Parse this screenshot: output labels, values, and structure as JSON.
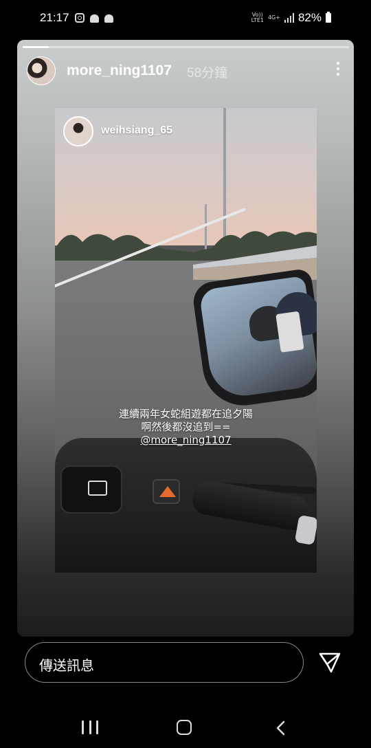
{
  "status_bar": {
    "time": "21:17",
    "network_type_top": "Vo))",
    "network_type_bottom": "LTE1",
    "network_gen": "4G+",
    "battery": "82%",
    "icons": [
      "instagram-icon",
      "android-icon",
      "android-icon",
      "signal-icon",
      "battery-icon"
    ]
  },
  "story": {
    "progress": 0.08,
    "username": "more_ning1107",
    "timestamp": "58分鐘",
    "more_icon": "more-vertical-icon",
    "shared_post": {
      "username": "weihsiang_65",
      "caption_line1": "連續兩年女蛇組遊都在追夕陽",
      "caption_line2": "啊然後都沒追到==",
      "mention": "@more_ning1107"
    }
  },
  "reply": {
    "placeholder": "傳送訊息",
    "send_icon": "send-icon"
  },
  "nav": {
    "icons": [
      "recent-apps-icon",
      "home-icon",
      "back-icon"
    ]
  },
  "colors": {
    "background": "#000000",
    "text": "#ffffff",
    "accent_orange": "#e56b2f"
  }
}
